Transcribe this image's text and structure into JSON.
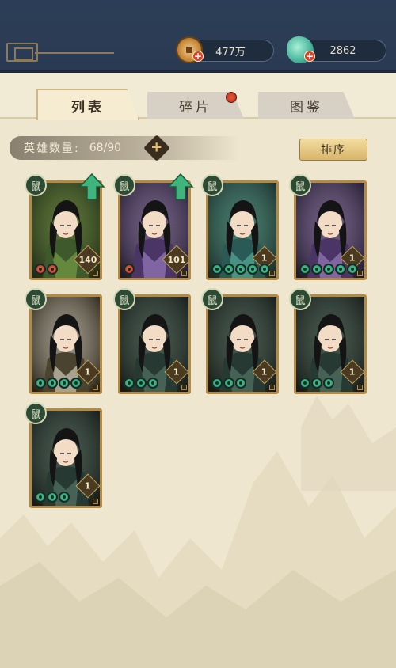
{
  "currencies": {
    "coins": "477万",
    "jade": "2862"
  },
  "tabs": [
    {
      "label": "列表",
      "active": true
    },
    {
      "label": "碎片",
      "active": false,
      "has_notification": true
    },
    {
      "label": "图鉴",
      "active": false
    }
  ],
  "hero_count": {
    "label": "英雄数量:",
    "value": "68/90"
  },
  "sort_button": "排序",
  "heroes": [
    {
      "faction": "鼠",
      "level": "140",
      "gems": [
        "red",
        "red"
      ],
      "upgrade": true,
      "palette": "green-dark"
    },
    {
      "faction": "鼠",
      "level": "101",
      "gems": [
        "red"
      ],
      "upgrade": true,
      "palette": "purple"
    },
    {
      "faction": "鼠",
      "level": "1",
      "gems": [
        "green",
        "green",
        "green",
        "green",
        "green"
      ],
      "upgrade": false,
      "palette": "teal"
    },
    {
      "faction": "鼠",
      "level": "1",
      "gems": [
        "green",
        "green",
        "green",
        "green",
        "green"
      ],
      "upgrade": false,
      "palette": "purple"
    },
    {
      "faction": "鼠",
      "level": "1",
      "gems": [
        "green",
        "green",
        "green",
        "green"
      ],
      "upgrade": false,
      "palette": "fur"
    },
    {
      "faction": "鼠",
      "level": "1",
      "gems": [
        "green",
        "green",
        "green"
      ],
      "upgrade": false,
      "palette": "dark"
    },
    {
      "faction": "鼠",
      "level": "1",
      "gems": [
        "green",
        "green",
        "green"
      ],
      "upgrade": false,
      "palette": "dark"
    },
    {
      "faction": "鼠",
      "level": "1",
      "gems": [
        "green",
        "green",
        "green"
      ],
      "upgrade": false,
      "palette": "dark"
    },
    {
      "faction": "鼠",
      "level": "1",
      "gems": [
        "green",
        "green",
        "green"
      ],
      "upgrade": false,
      "palette": "dark"
    }
  ],
  "colors": {
    "topbar": "#2c3e57",
    "panel": "#efe6cf",
    "card_border": "#b28a43",
    "gem_green": "#1a8c68",
    "gem_red": "#b0261a",
    "upgrade_arrow": "#3fb47c"
  }
}
